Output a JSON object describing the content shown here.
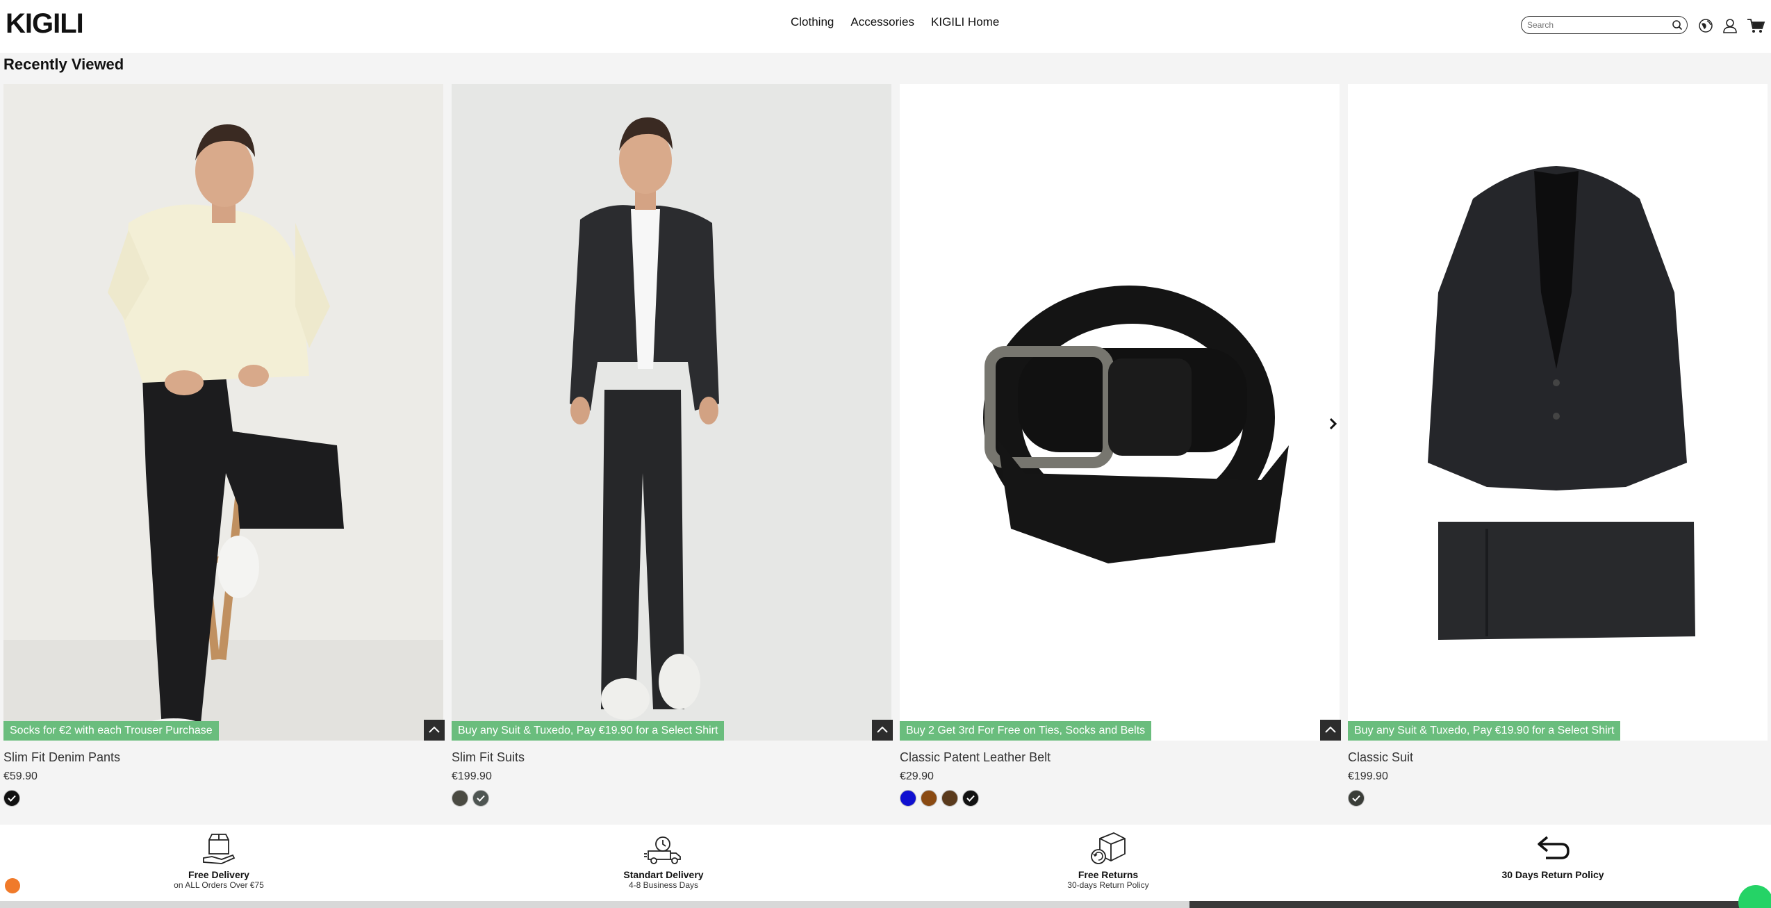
{
  "brand": {
    "logo_text": "KIGILI"
  },
  "nav": {
    "items": [
      "Clothing",
      "Accessories",
      "KIGILI Home"
    ]
  },
  "search": {
    "placeholder": "Search"
  },
  "section": {
    "title": "Recently Viewed"
  },
  "products": [
    {
      "name": "Slim Fit Denim Pants",
      "price": "€59.90",
      "badge": "Socks for €2 with each Trouser Purchase",
      "swatches": [
        "#111111"
      ]
    },
    {
      "name": "Slim Fit Suits",
      "price": "€199.90",
      "badge": "Buy any Suit & Tuxedo, Pay €19.90 for a Select Shirt",
      "swatches": [
        "#4a4a42",
        "#4e5552"
      ]
    },
    {
      "name": "Classic Patent Leather Belt",
      "price": "€29.90",
      "badge": "Buy 2 Get 3rd For Free on Ties, Socks and Belts",
      "swatches": [
        "#1010d0",
        "#8a4a12",
        "#5a3a1c",
        "#111111"
      ]
    },
    {
      "name": "Classic Suit",
      "price": "€199.90",
      "badge": "Buy any Suit & Tuxedo, Pay €19.90 for a Select Shirt",
      "swatches": [
        "#3a3d38"
      ]
    }
  ],
  "features": [
    {
      "title": "Free Delivery",
      "subtitle": "on ALL Orders Over €75",
      "icon": "box-hand-icon"
    },
    {
      "title": "Standart Delivery",
      "subtitle": "4-8 Business Days",
      "icon": "delivery-truck-icon"
    },
    {
      "title": "Free Returns",
      "subtitle": "30-days Return Policy",
      "icon": "return-box-icon"
    },
    {
      "title": "30 Days Return Policy",
      "subtitle": "",
      "icon": "return-arrow-icon"
    }
  ],
  "colors": {
    "badge": "#6abd7d",
    "page_bg": "#f4f4f4",
    "header_bg": "#ffffff"
  }
}
